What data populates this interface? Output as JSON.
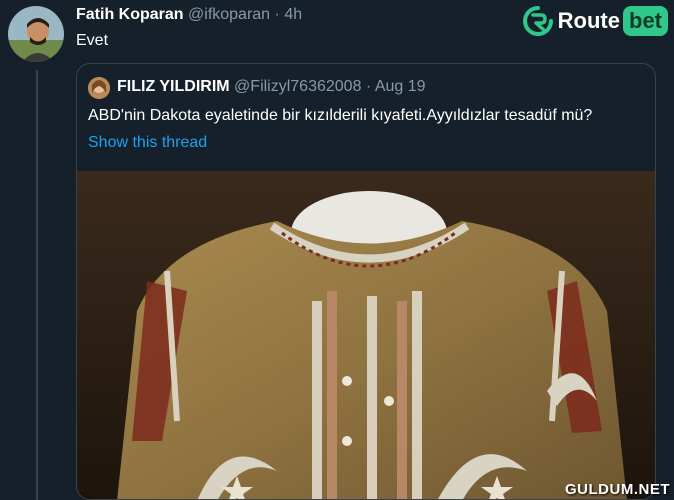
{
  "tweet": {
    "author_name": "Fatih Koparan",
    "author_handle": "@ifkoparan",
    "separator": "·",
    "time": "4h",
    "text": "Evet"
  },
  "brand": {
    "word": "Route",
    "pill": "bet",
    "accent_color": "#2fc78a"
  },
  "quoted_tweet": {
    "author_name": "FILIZ YILDIRIM",
    "author_handle": "@Filizyl76362008",
    "separator": "·",
    "date": "Aug 19",
    "text": "ABD'nin Dakota eyaletinde bir kızılderili kıyafeti.Ayyıldızlar tesadüf mü?",
    "show_thread_label": "Show this thread"
  },
  "watermark": "GULDUM.NET",
  "theme": {
    "background": "#15202b",
    "border": "#38444d",
    "muted_text": "#8899a6",
    "link_color": "#1da1f2"
  }
}
